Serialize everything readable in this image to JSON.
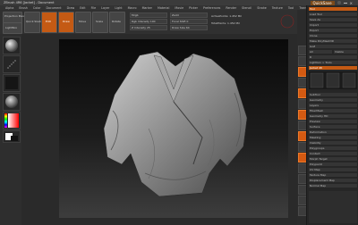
{
  "app": {
    "title": "ZBrush 4R6 [Jacket] - Document",
    "quicksave": "QuickSave",
    "menu": [
      "Alpha",
      "Brush",
      "Color",
      "Document",
      "Draw",
      "Edit",
      "File",
      "Layer",
      "Light",
      "Macro",
      "Marker",
      "Material",
      "Movie",
      "Picker",
      "Preferences",
      "Render",
      "Stencil",
      "Stroke",
      "Texture",
      "Tool",
      "Transform",
      "Zplugin",
      "Zscript"
    ]
  },
  "topshelf": {
    "projection_master": "Projection Master",
    "lightbox": "LightBox",
    "quick_sketch": "Quick Sketch",
    "edit": "Edit",
    "draw": "Draw",
    "move": "Move",
    "scale": "Scale",
    "rotate": "Rotate",
    "mrgb": "Mrgb",
    "rgb": "Rgb",
    "m": "M",
    "zadd": "Zadd",
    "zsub": "Zsub",
    "focal_shift": "Focal Shift 0",
    "draw_size": "Draw Size 64",
    "rgb_intensity": "Rgb Intensity 100",
    "z_intensity": "Z Intensity 25",
    "active_points": "ActivePoints: 1.452 Mil",
    "total_points": "TotalPoints: 1.452 Mil"
  },
  "tray": {
    "items": [
      "Tool",
      "Load Tool",
      "Save As",
      "Import",
      "Export",
      "Clone",
      "Make PolyMesh3D",
      "GoZ",
      "All",
      "Visible",
      "R",
      "Lightbox > Tools",
      "Jacket 48",
      "SubTool",
      "Geometry",
      "Layers",
      "FiberMesh",
      "Geometry HD",
      "Preview",
      "Surface",
      "Deformation",
      "Masking",
      "Visibility",
      "Polygroups",
      "Contact",
      "Morph Target",
      "Polypaint",
      "UV Map",
      "Texture Map",
      "Displacement Map",
      "Normal Map"
    ]
  },
  "colors": {
    "accent": "#d45a12",
    "canvas_dark": "#0a0a0a",
    "canvas_light": "#3d3d3d"
  }
}
